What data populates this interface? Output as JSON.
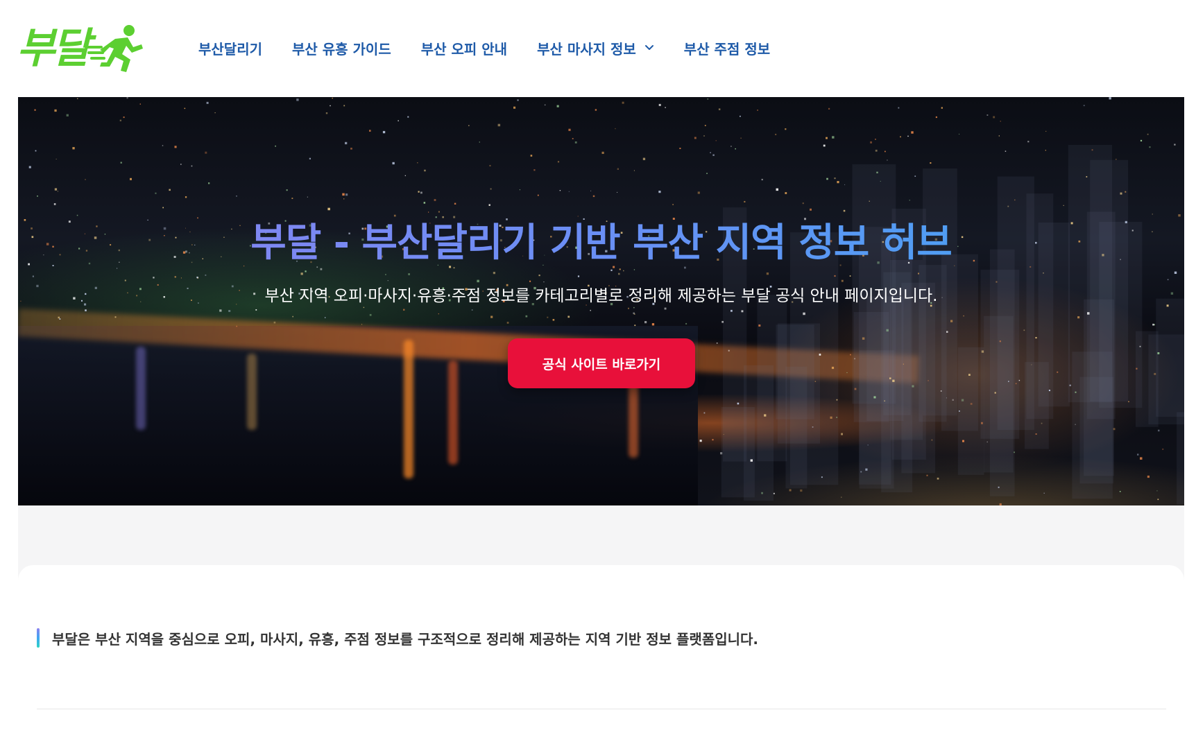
{
  "header": {
    "logo_text": "부달",
    "nav": [
      {
        "label": "부산달리기"
      },
      {
        "label": "부산 유흥 가이드"
      },
      {
        "label": "부산 오피 안내"
      },
      {
        "label": "부산 마사지 정보"
      },
      {
        "label": "부산 주점 정보"
      }
    ]
  },
  "hero": {
    "title": "부달 - 부산달리기 기반 부산 지역 정보 허브",
    "subtitle": "부산 지역 오피·마사지·유흥·주점 정보를 카테고리별로 정리해 제공하는 부달 공식 안내 페이지입니다.",
    "button_label": "공식 사이트 바로가기"
  },
  "content": {
    "intro": "부달은 부산 지역을 중심으로 오피, 마사지, 유흥, 주점 정보를 구조적으로 정리해 제공하는 지역 기반 정보 플랫폼입니다."
  },
  "colors": {
    "logo_green": "#5ccf31",
    "nav_blue": "#1e5aa8",
    "cta_red": "#e8103a",
    "title_gradient_start": "#8c82f0",
    "title_gradient_end": "#3fa7f2"
  },
  "icons": {
    "logo_runner": "runner-icon",
    "dropdown": "chevron-down-icon"
  }
}
